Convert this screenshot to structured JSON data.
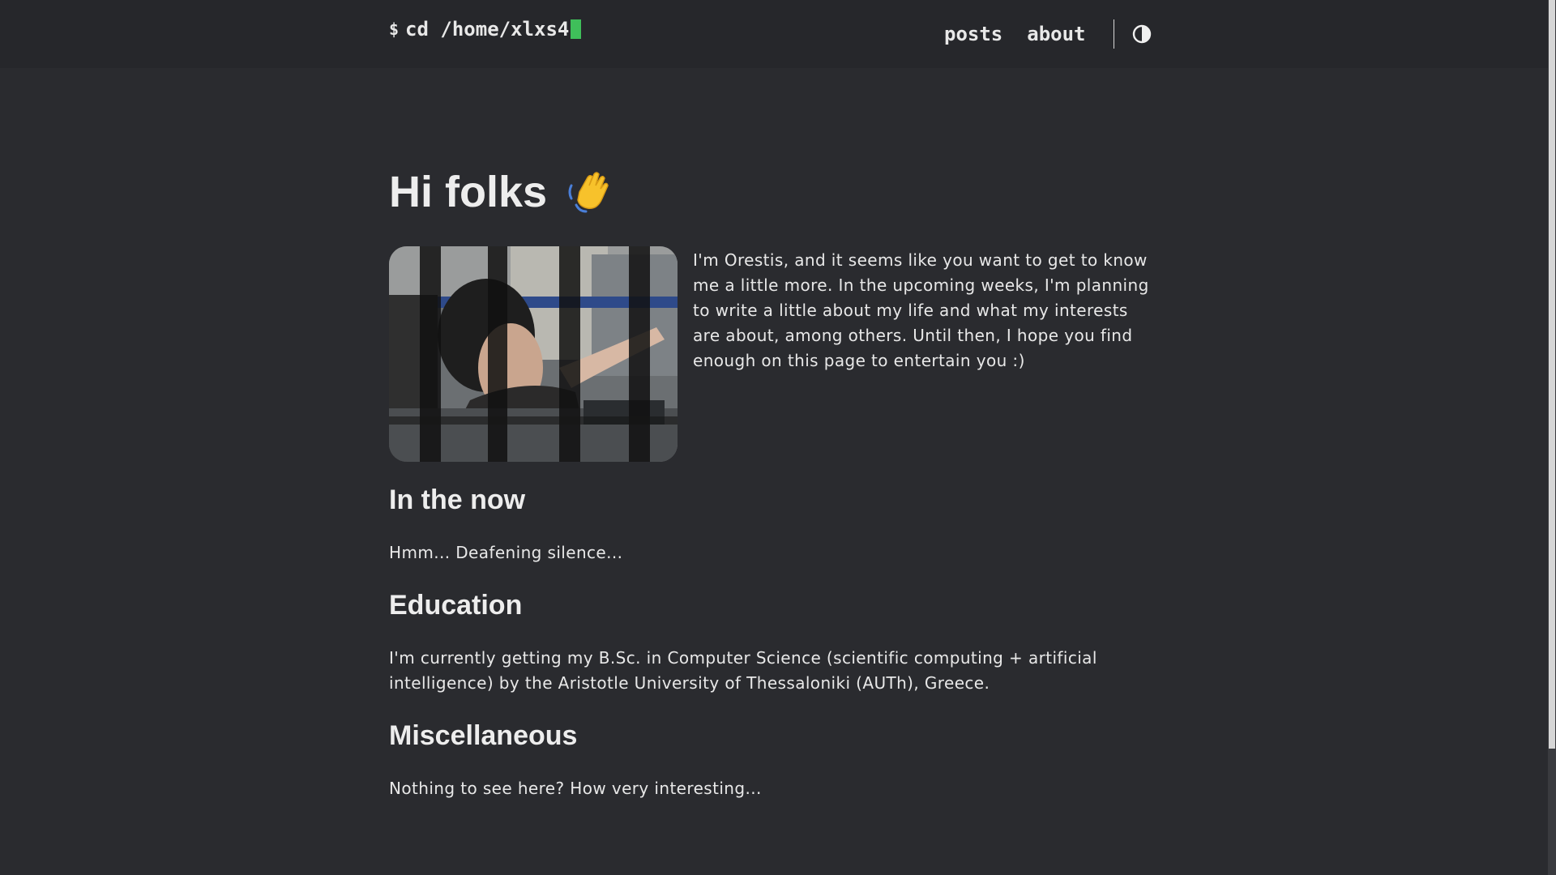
{
  "header": {
    "prompt": "$",
    "command": "cd /home/xlxs4",
    "nav": [
      {
        "label": "posts"
      },
      {
        "label": "about"
      }
    ],
    "theme_toggle_icon": "contrast-icon",
    "cursor_color": "#3fbf5a"
  },
  "main": {
    "title": "Hi folks",
    "title_emoji_icon": "waving-hand-icon",
    "intro_text": "I'm Orestis, and it seems like you want to get to know me a little more. In the upcoming weeks, I'm planning to write a little about my life and what my interests are about, among others. Until then, I hope you find enough on this page to entertain you :)",
    "sections": [
      {
        "heading": "In the now",
        "text": "Hmm... Deafening silence..."
      },
      {
        "heading": "Education",
        "text": "I'm currently getting my B.Sc. in Computer Science (scientific computing + artificial intelligence) by the Aristotle University of Thessaloniki (AUTh), Greece."
      },
      {
        "heading": "Miscellaneous",
        "text": "Nothing to see here? How very interesting..."
      }
    ]
  },
  "colors": {
    "background": "#2a2b2f",
    "header_background": "#26272b",
    "text": "#e8e8e8"
  }
}
